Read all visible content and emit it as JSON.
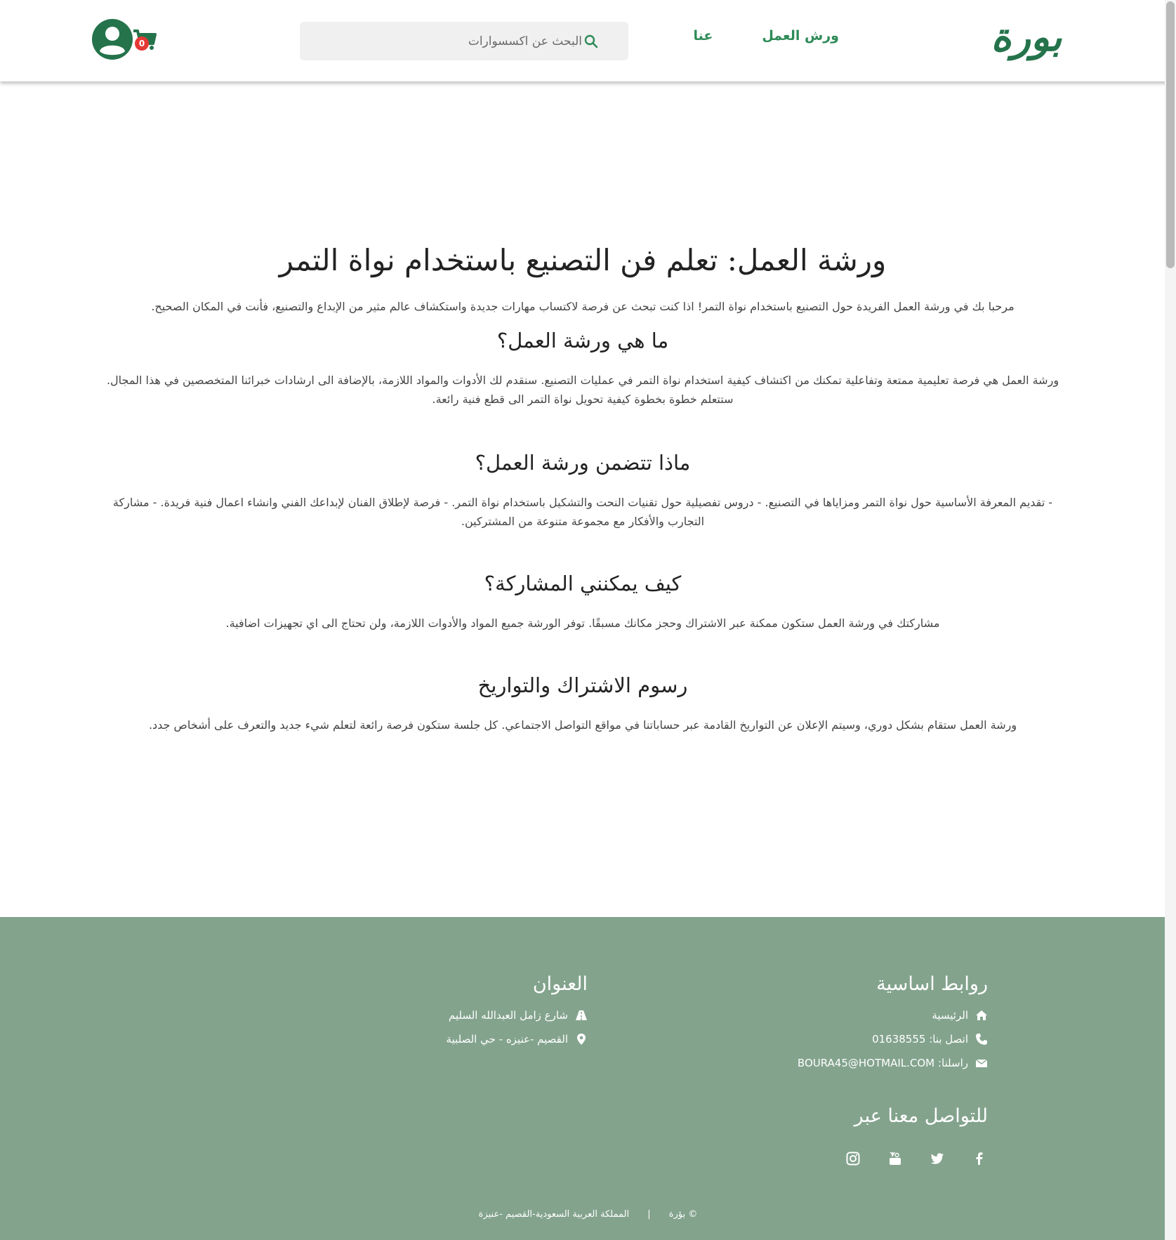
{
  "header": {
    "logo_text": "بورة",
    "nav": [
      {
        "label": "ورش العمل"
      },
      {
        "label": "عنا"
      }
    ],
    "search": {
      "placeholder": "البحث عن اكسسوارات"
    },
    "cart_count": "0",
    "icons": {
      "search": "search-icon",
      "cart": "cart-icon",
      "user": "user-icon"
    }
  },
  "main": {
    "title": "ورشة العمل: تعلم فن التصنيع باستخدام نواة التمر",
    "intro": "مرحبا بك في ورشة العمل الفريدة حول التصنيع باستخدام نواة التمر! اذا كنت تبحث عن فرصة لاكتساب مهارات جديدة واستكشاف عالم مثير من الإبداع والتصنيع، فأنت في المكان الصحيح.",
    "sections": [
      {
        "heading": "ما هي ورشة العمل؟",
        "text": "ورشة العمل هي فرصة تعليمية ممتعة وتفاعلية تمكنك من اكتشاف كيفية استخدام نواة التمر في عمليات التصنيع. سنقدم لك الأدوات والمواد اللازمة، بالإضافة الى ارشادات خبرائنا المتخصصين في هذا المجال. ستتعلم خطوة بخطوة كيفية تحويل نواة التمر الى قطع فنية رائعة."
      },
      {
        "heading": "ماذا تتضمن ورشة العمل؟",
        "text": "- تقديم المعرفة الأساسية حول نواة التمر ومزاياها في التصنيع. - دروس تفصيلية حول تقنيات النحت والتشكيل باستخدام نواة التمر. - فرصة لإطلاق الفنان لإبداعك الفني وانشاء اعمال فنية فريدة. - مشاركة التجارب والأفكار مع مجموعة متنوعة من المشتركين."
      },
      {
        "heading": "كيف يمكنني المشاركة؟",
        "text": "مشاركتك في ورشة العمل ستكون ممكنة عبر الاشتراك وحجز مكانك مسبقًا. توفر الورشة جميع المواد والأدوات اللازمة، ولن تحتاج الى اي تجهيزات اضافية."
      },
      {
        "heading": "رسوم الاشتراك والتواريخ",
        "text": "ورشة العمل ستقام بشكل دوري، وسيتم الإعلان عن التواريخ القادمة عبر حساباتنا في مواقع التواصل الاجتماعي. كل جلسة ستكون فرصة رائعة لتعلم شيء جديد والتعرف على أشخاص جدد."
      }
    ]
  },
  "footer": {
    "links": {
      "title": "روابط اساسية",
      "home": "الرئيسية",
      "phone": "اتصل بنا: 01638555",
      "email": "راسلنا: BOURA45@HOTMAIL.COM"
    },
    "address": {
      "title": "العنوان",
      "street": "شارع زامل العبدالله السليم",
      "location": "القصيم -عنيزه - حي الصلبية"
    },
    "social_title": "للتواصل معنا عبر",
    "social_icons": [
      "facebook-icon",
      "twitter-icon",
      "youtube-icon",
      "instagram-icon"
    ],
    "copyright": "© بؤرة",
    "country": "المملكة العربية السعودية-القصيم -عنيزة",
    "separator": "|"
  },
  "colors": {
    "brand_green": "#24734b",
    "nav_green": "#2e8b57",
    "footer_bg": "#83a38d",
    "badge_red": "#e53935"
  }
}
